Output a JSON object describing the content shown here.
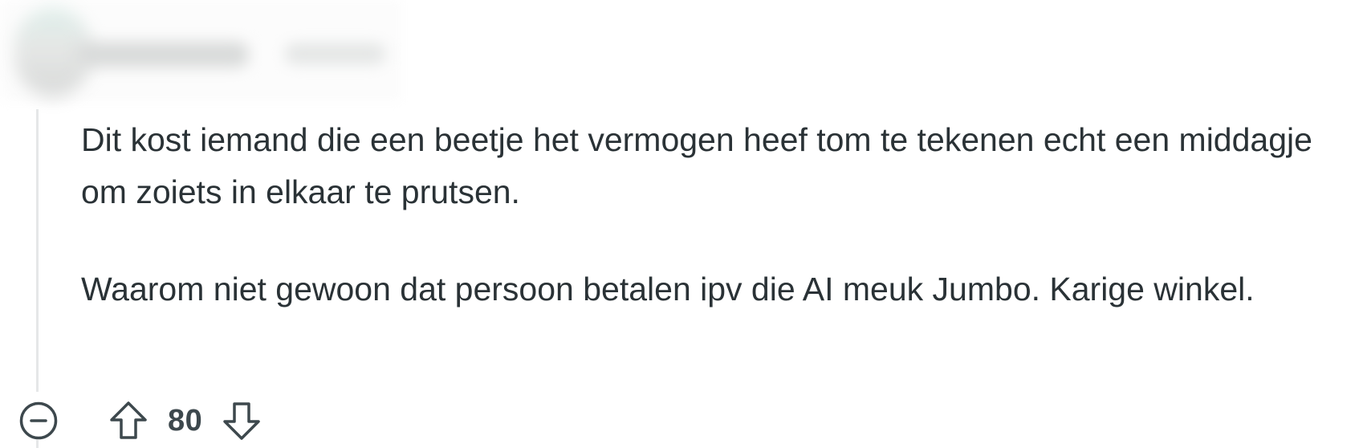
{
  "comment": {
    "author": "",
    "timestamp": "",
    "paragraphs": [
      "Dit kost iemand die een beetje het vermogen heef tom te tekenen echt een middagje om zoiets in elkaar te prutsen.",
      "Waarom niet gewoon dat persoon betalen ipv die AI meuk Jumbo. Karige winkel."
    ]
  },
  "actions": {
    "collapse_icon": "minus-circle-icon",
    "upvote_icon": "arrow-up-icon",
    "downvote_icon": "arrow-down-icon",
    "score": "80"
  },
  "colors": {
    "text": "#2a3236",
    "icon": "#3d484d",
    "thread_line": "#e5e7e8",
    "background": "#ffffff"
  }
}
